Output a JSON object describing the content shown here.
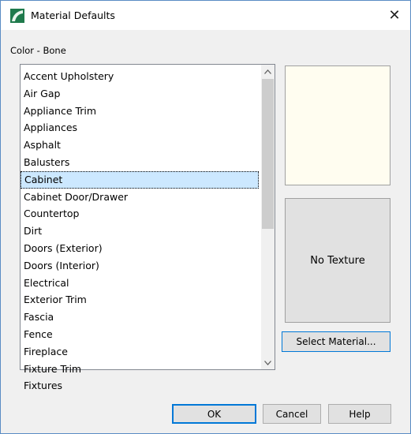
{
  "window": {
    "title": "Material Defaults",
    "close_label": "✕",
    "icon": "material-defaults-app-icon"
  },
  "color_label": "Color - Bone",
  "list": {
    "items": [
      "Accent Upholstery",
      "Air Gap",
      "Appliance Trim",
      "Appliances",
      "Asphalt",
      "Balusters",
      "Cabinet",
      "Cabinet Door/Drawer",
      "Countertop",
      "Dirt",
      "Doors (Exterior)",
      "Doors (Interior)",
      "Electrical",
      "Exterior Trim",
      "Fascia",
      "Fence",
      "Fireplace",
      "Fixture Trim",
      "Fixtures"
    ],
    "selected": "Cabinet"
  },
  "preview": {
    "color_hex": "#fffdf0",
    "texture_label": "No Texture"
  },
  "buttons": {
    "select_material": "Select Material...",
    "ok": "OK",
    "cancel": "Cancel",
    "help": "Help"
  },
  "colors": {
    "accent": "#0078d7",
    "selection": "#cce8ff",
    "icon_green": "#1f7a4c"
  }
}
